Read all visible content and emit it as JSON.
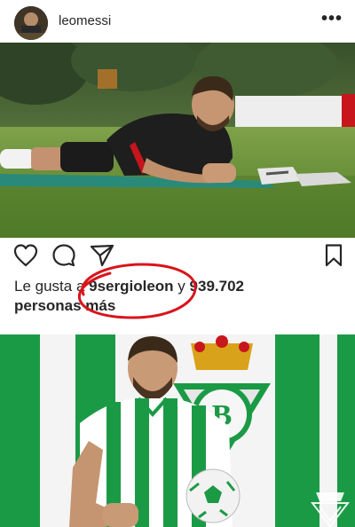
{
  "post": {
    "username": "leomessi",
    "more_icon": "ellipsis-icon"
  },
  "actions": {
    "like_icon": "heart-icon",
    "comment_icon": "comment-icon",
    "share_icon": "send-icon",
    "save_icon": "bookmark-icon"
  },
  "likes": {
    "prefix": "Le gusta a",
    "user": "9sergioleon",
    "middle": "y",
    "count": "939.702",
    "suffix": "personas más"
  },
  "annotation": {
    "circle_color": "#d9141c"
  },
  "photo2": {
    "watermark": "crest-watermark"
  },
  "colors": {
    "betis_green": "#1b9a45",
    "grass": "#4f7d2e"
  }
}
